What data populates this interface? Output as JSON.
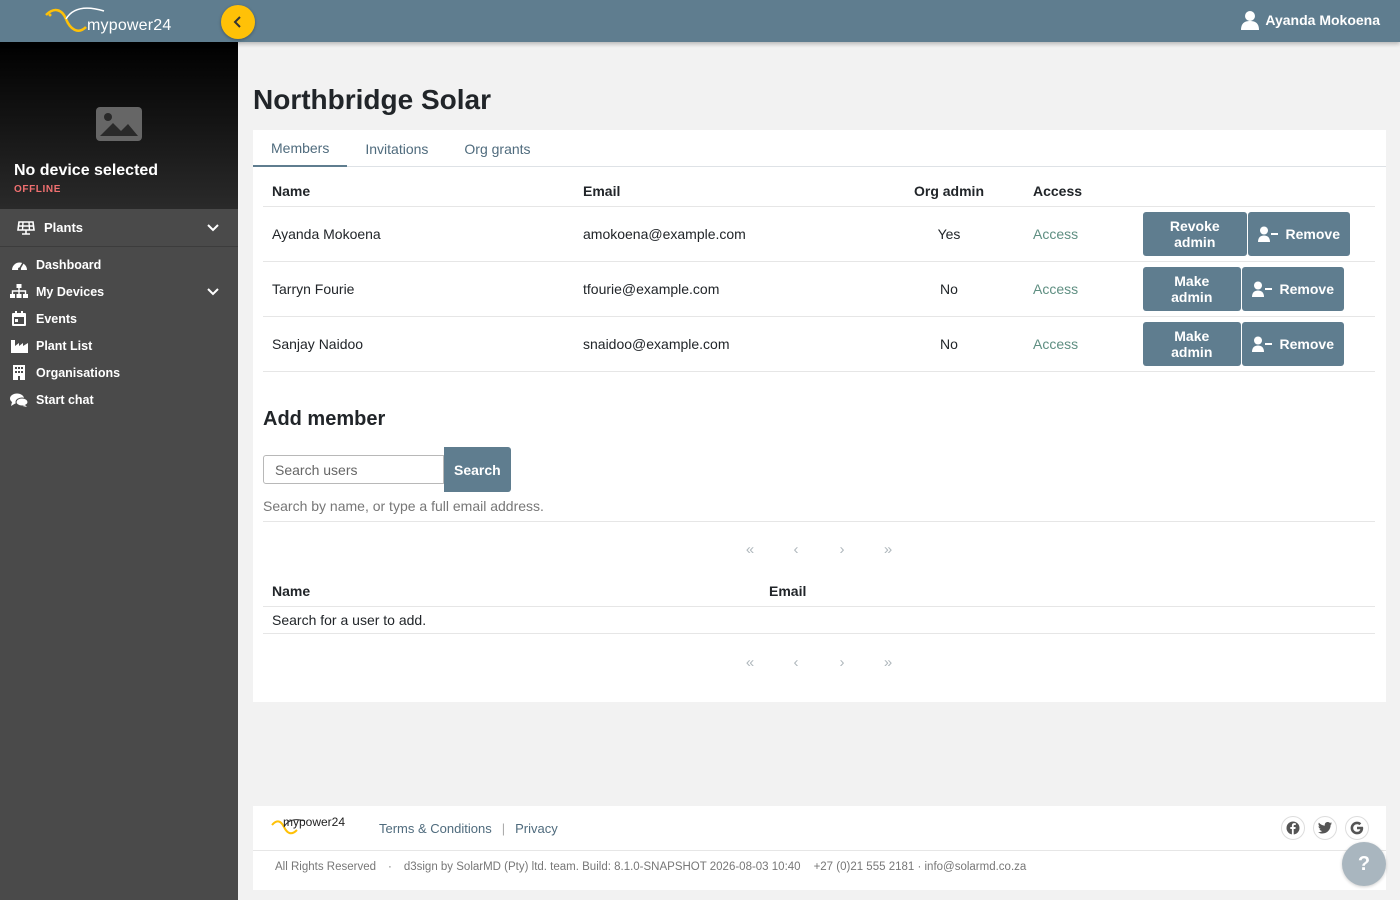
{
  "app": {
    "logo_text": "mypower24",
    "user_name": "Ayanda Mokoena",
    "brand_color": "#5f7d8f",
    "accent_color": "#ffc107"
  },
  "sidebar": {
    "device_title": "No device selected",
    "device_status": "OFFLINE",
    "plants_label": "Plants",
    "items": [
      {
        "label": "Dashboard",
        "icon": "dashboard-icon"
      },
      {
        "label": "My Devices",
        "icon": "sitemap-icon"
      },
      {
        "label": "Events",
        "icon": "calendar-icon"
      },
      {
        "label": "Plant List",
        "icon": "industry-icon"
      },
      {
        "label": "Organisations",
        "icon": "building-icon"
      },
      {
        "label": "Start chat",
        "icon": "chat-icon"
      }
    ]
  },
  "page": {
    "title": "Northbridge Solar",
    "tabs": [
      "Members",
      "Invitations",
      "Org grants"
    ],
    "active_tab": "Members"
  },
  "members": {
    "headers": [
      "Name",
      "Email",
      "Org admin",
      "Access"
    ],
    "rows": [
      {
        "name": "Ayanda Mokoena",
        "email": "amokoena@example.com",
        "org_admin": "Yes",
        "access": "Access",
        "admin_action": "Revoke admin",
        "remove": "Remove"
      },
      {
        "name": "Tarryn Fourie",
        "email": "tfourie@example.com",
        "org_admin": "No",
        "access": "Access",
        "admin_action": "Make admin",
        "remove": "Remove"
      },
      {
        "name": "Sanjay Naidoo",
        "email": "snaidoo@example.com",
        "org_admin": "No",
        "access": "Access",
        "admin_action": "Make admin",
        "remove": "Remove"
      }
    ]
  },
  "add_member": {
    "title": "Add member",
    "search_placeholder": "Search users",
    "search_button": "Search",
    "hint": "Search by name, or type a full email address.",
    "pager": [
      "«",
      "‹",
      "›",
      "»"
    ],
    "headers": [
      "Name",
      "Email"
    ],
    "empty_message": "Search for a user to add."
  },
  "footer": {
    "logo_text": "mypower24",
    "links": [
      "Terms & Conditions",
      "Privacy"
    ],
    "rights": "All Rights Reserved",
    "separator": "·",
    "credits": "d3sign by SolarMD (Pty) ltd. team. Build: 8.1.0-SNAPSHOT 2026-08-03 10:40",
    "contact": "+27 (0)21 555 2181 · info@solarmd.co.za",
    "social": [
      "facebook-icon",
      "twitter-icon",
      "google-icon"
    ]
  },
  "help": {
    "label": "?"
  }
}
